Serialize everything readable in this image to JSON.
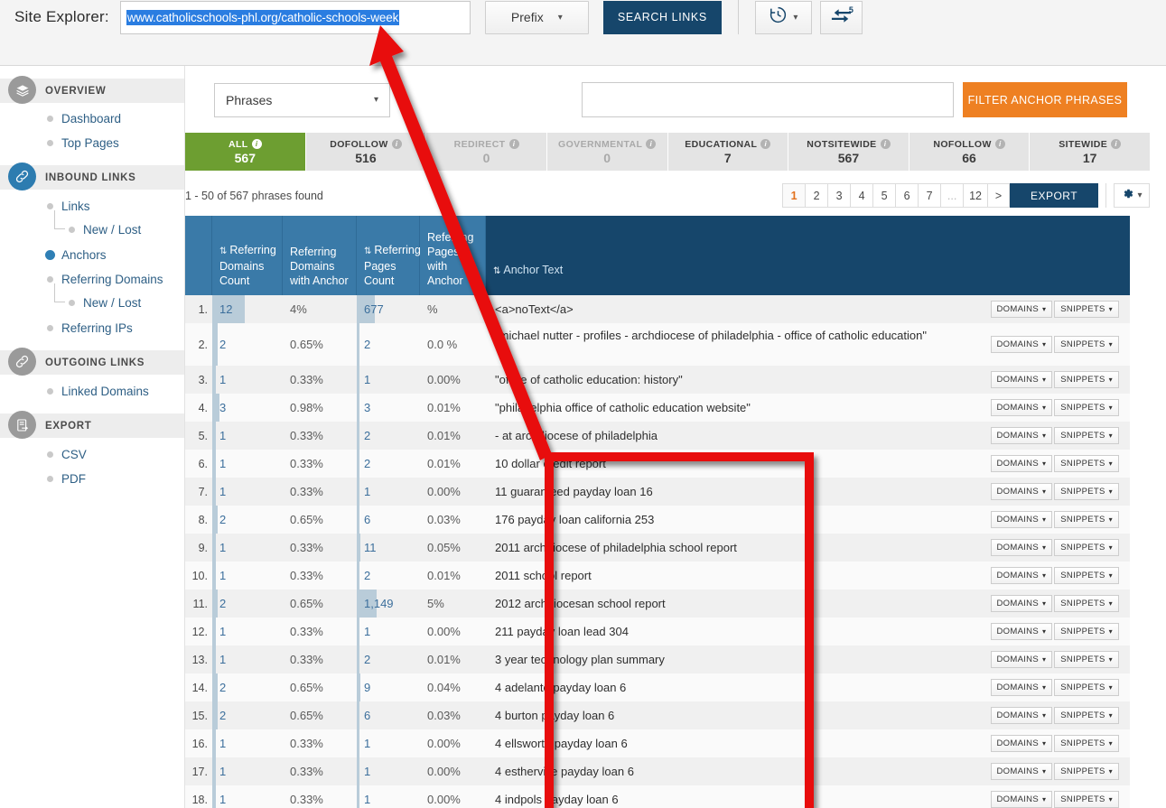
{
  "header": {
    "site_explorer_label": "Site Explorer:",
    "url_value": "www.catholicschools-phl.org/catholic-schools-week",
    "prefix_label": "Prefix",
    "search_links_label": "SEARCH LINKS",
    "history_icon": "history-clock-icon",
    "compare_icon": "compare-arrows-icon",
    "compare_badge": "5"
  },
  "sidebar": {
    "groups": [
      {
        "label": "OVERVIEW",
        "icon": "layers-icon",
        "items": [
          {
            "label": "Dashboard",
            "sub": false,
            "active": false
          },
          {
            "label": "Top Pages",
            "sub": false,
            "active": false
          }
        ]
      },
      {
        "label": "INBOUND LINKS",
        "icon": "link-chain-icon",
        "items": [
          {
            "label": "Links",
            "sub": false,
            "active": false
          },
          {
            "label": "New",
            "label2": "Lost",
            "sub": true,
            "active": false
          },
          {
            "label": "Anchors",
            "sub": false,
            "active": true
          },
          {
            "label": "Referring Domains",
            "sub": false,
            "active": false
          },
          {
            "label": "New",
            "label2": "Lost",
            "sub": true,
            "active": false
          },
          {
            "label": "Referring IPs",
            "sub": false,
            "active": false
          }
        ]
      },
      {
        "label": "OUTGOING LINKS",
        "icon": "link-chain-icon",
        "items": [
          {
            "label": "Linked Domains",
            "sub": false,
            "active": false
          }
        ]
      },
      {
        "label": "EXPORT",
        "icon": "export-doc-icon",
        "items": [
          {
            "label": "CSV",
            "sub": false,
            "active": false
          },
          {
            "label": "PDF",
            "sub": false,
            "active": false
          }
        ]
      }
    ],
    "sub_separator": "/"
  },
  "filters": {
    "mode_select_value": "Phrases",
    "anchor_input_value": "",
    "anchor_input_placeholder": "",
    "filter_button_label": "FILTER ANCHOR PHRASES",
    "tabs": [
      {
        "label": "ALL",
        "count": "567",
        "state": "active"
      },
      {
        "label": "DOFOLLOW",
        "count": "516",
        "state": "normal"
      },
      {
        "label": "REDIRECT",
        "count": "0",
        "state": "dim"
      },
      {
        "label": "GOVERNMENTAL",
        "count": "0",
        "state": "dim"
      },
      {
        "label": "EDUCATIONAL",
        "count": "7",
        "state": "normal"
      },
      {
        "label": "NOTSITEWIDE",
        "count": "567",
        "state": "normal"
      },
      {
        "label": "NOFOLLOW",
        "count": "66",
        "state": "normal"
      },
      {
        "label": "SITEWIDE",
        "count": "17",
        "state": "normal"
      }
    ]
  },
  "results": {
    "found_text": "1 - 50 of 567 phrases found",
    "pages": [
      "1",
      "2",
      "3",
      "4",
      "5",
      "6",
      "7",
      "...",
      "12",
      ">"
    ],
    "current_page": "1",
    "export_label": "EXPORT",
    "gear_icon": "gear-icon"
  },
  "table": {
    "columns": [
      {
        "key": "num",
        "label": "",
        "sortable": false
      },
      {
        "key": "c1",
        "label": "Referring Domains Count",
        "sortable": true
      },
      {
        "key": "c2",
        "label": "Referring Domains with Anchor",
        "sortable": false
      },
      {
        "key": "c3",
        "label": "Referring Pages Count",
        "sortable": true
      },
      {
        "key": "c4",
        "label": "Referring Pages with Anchor",
        "sortable": false
      },
      {
        "key": "anchor",
        "label": "Anchor Text",
        "sortable": true
      }
    ],
    "row_actions": {
      "domains": "DOMAINS",
      "snippets": "SNIPPETS"
    },
    "rows": [
      {
        "n": "1.",
        "rdc": "12",
        "rdwa": "4%",
        "rpc": "677",
        "rpwa": "%",
        "anchor": "<a>noText</a>",
        "bar1": 36,
        "bar3": 20
      },
      {
        "n": "2.",
        "rdc": "2",
        "rdwa": "0.65%",
        "rpc": "2",
        "rpwa": "0.0 %",
        "anchor": "\"michael nutter - profiles - archdiocese of philadelphia - office of catholic education\"",
        "bar1": 6,
        "bar3": 3,
        "tall": true
      },
      {
        "n": "3.",
        "rdc": "1",
        "rdwa": "0.33%",
        "rpc": "1",
        "rpwa": "0.00%",
        "anchor": "\"office of catholic education: history\"",
        "bar1": 4,
        "bar3": 3
      },
      {
        "n": "4.",
        "rdc": "3",
        "rdwa": "0.98%",
        "rpc": "3",
        "rpwa": "0.01%",
        "anchor": "\"philadelphia office of catholic education website\"",
        "bar1": 8,
        "bar3": 3
      },
      {
        "n": "5.",
        "rdc": "1",
        "rdwa": "0.33%",
        "rpc": "2",
        "rpwa": "0.01%",
        "anchor": "- at archdiocese of philadelphia",
        "bar1": 4,
        "bar3": 3
      },
      {
        "n": "6.",
        "rdc": "1",
        "rdwa": "0.33%",
        "rpc": "2",
        "rpwa": "0.01%",
        "anchor": "10 dollar credit report",
        "bar1": 4,
        "bar3": 3
      },
      {
        "n": "7.",
        "rdc": "1",
        "rdwa": "0.33%",
        "rpc": "1",
        "rpwa": "0.00%",
        "anchor": "11 guaranteed payday loan 16",
        "bar1": 4,
        "bar3": 3
      },
      {
        "n": "8.",
        "rdc": "2",
        "rdwa": "0.65%",
        "rpc": "6",
        "rpwa": "0.03%",
        "anchor": "176 payday loan california 253",
        "bar1": 6,
        "bar3": 3
      },
      {
        "n": "9.",
        "rdc": "1",
        "rdwa": "0.33%",
        "rpc": "11",
        "rpwa": "0.05%",
        "anchor": "2011 archdiocese of philadelphia school report",
        "bar1": 4,
        "bar3": 4
      },
      {
        "n": "10.",
        "rdc": "1",
        "rdwa": "0.33%",
        "rpc": "2",
        "rpwa": "0.01%",
        "anchor": "2011 school report",
        "bar1": 4,
        "bar3": 3
      },
      {
        "n": "11.",
        "rdc": "2",
        "rdwa": "0.65%",
        "rpc": "1,149",
        "rpwa": "5%",
        "anchor": "2012 archdiocesan school report",
        "bar1": 6,
        "bar3": 22
      },
      {
        "n": "12.",
        "rdc": "1",
        "rdwa": "0.33%",
        "rpc": "1",
        "rpwa": "0.00%",
        "anchor": "211 payday loan lead 304",
        "bar1": 4,
        "bar3": 3
      },
      {
        "n": "13.",
        "rdc": "1",
        "rdwa": "0.33%",
        "rpc": "2",
        "rpwa": "0.01%",
        "anchor": "3 year technology plan summary",
        "bar1": 4,
        "bar3": 3
      },
      {
        "n": "14.",
        "rdc": "2",
        "rdwa": "0.65%",
        "rpc": "9",
        "rpwa": "0.04%",
        "anchor": "4 adelanto payday loan 6",
        "bar1": 6,
        "bar3": 4
      },
      {
        "n": "15.",
        "rdc": "2",
        "rdwa": "0.65%",
        "rpc": "6",
        "rpwa": "0.03%",
        "anchor": "4 burton payday loan 6",
        "bar1": 6,
        "bar3": 3
      },
      {
        "n": "16.",
        "rdc": "1",
        "rdwa": "0.33%",
        "rpc": "1",
        "rpwa": "0.00%",
        "anchor": "4 ellsworth payday loan 6",
        "bar1": 4,
        "bar3": 3
      },
      {
        "n": "17.",
        "rdc": "1",
        "rdwa": "0.33%",
        "rpc": "1",
        "rpwa": "0.00%",
        "anchor": "4 estherville payday loan 6",
        "bar1": 4,
        "bar3": 3
      },
      {
        "n": "18.",
        "rdc": "1",
        "rdwa": "0.33%",
        "rpc": "1",
        "rpwa": "0.00%",
        "anchor": "4 indpols payday loan 6",
        "bar1": 4,
        "bar3": 3
      }
    ]
  },
  "annotations": {
    "arrow_color": "#e81010",
    "box_color": "#e81010",
    "arrow_name": "red-callout-arrow",
    "box_name": "red-callout-rectangle"
  }
}
